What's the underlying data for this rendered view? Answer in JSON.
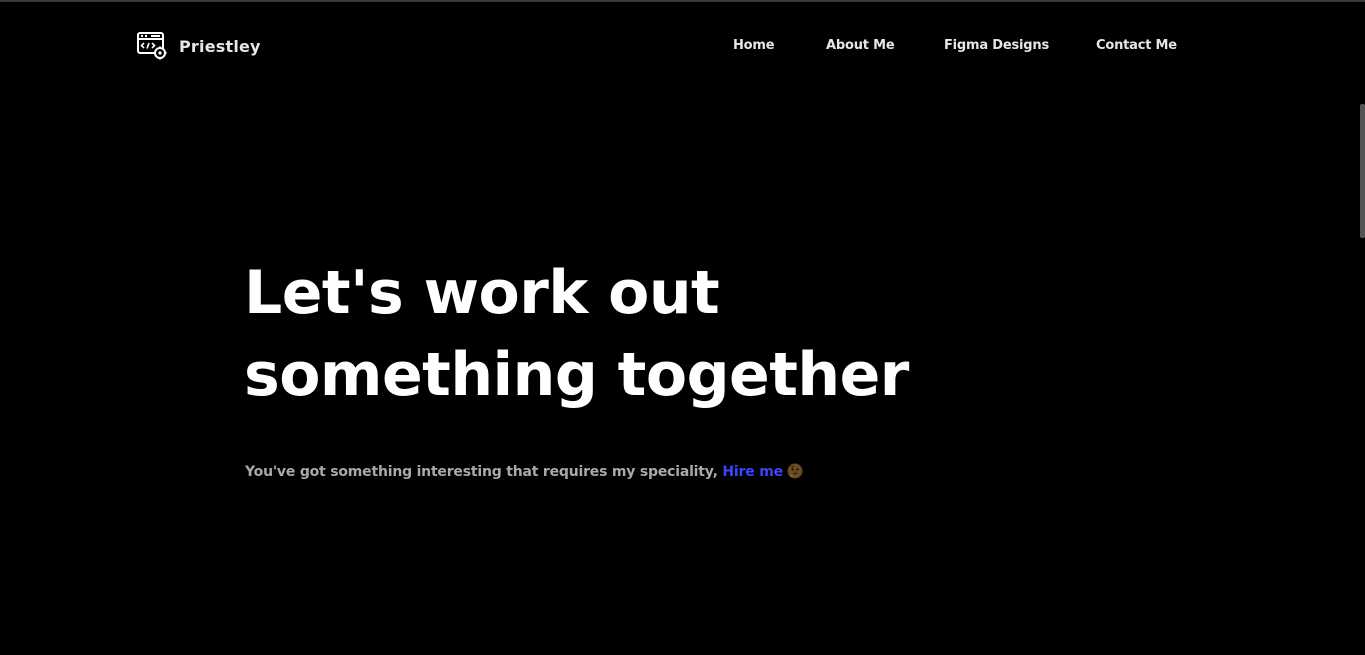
{
  "brand": {
    "name": "Priestley",
    "icon": "code-window-gear-icon"
  },
  "nav": {
    "items": [
      {
        "label": "Home"
      },
      {
        "label": "About Me"
      },
      {
        "label": "Figma Designs"
      },
      {
        "label": "Contact Me"
      }
    ]
  },
  "hero": {
    "title_line1": "Let's work out",
    "title_line2": "something together",
    "subtitle": "You've got something interesting that requires my speciality,",
    "cta_label": "Hire me",
    "emoji": "thinking-face-icon"
  },
  "colors": {
    "background": "#000000",
    "text": "#ffffff",
    "muted": "#a9a9a9",
    "accent": "#3d44ff"
  }
}
